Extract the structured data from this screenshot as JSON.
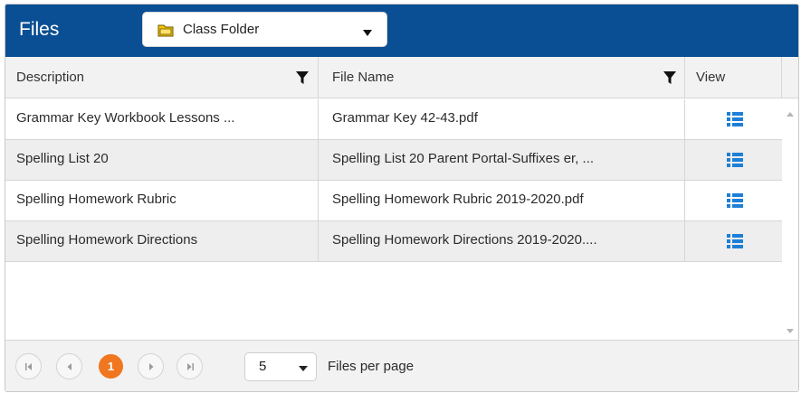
{
  "header": {
    "title": "Files",
    "folder_select": {
      "value": "Class Folder",
      "icon": "folder-icon"
    }
  },
  "grid": {
    "columns": {
      "description": "Description",
      "file_name": "File Name",
      "view": "View"
    },
    "rows": [
      {
        "description": "Grammar Key Workbook Lessons ...",
        "file_name": "Grammar Key 42-43.pdf",
        "view_icon": "list-view-icon"
      },
      {
        "description": "Spelling List 20",
        "file_name": "Spelling List 20 Parent Portal-Suffixes er, ...",
        "view_icon": "list-view-icon"
      },
      {
        "description": "Spelling Homework Rubric",
        "file_name": "Spelling Homework Rubric 2019-2020.pdf",
        "view_icon": "list-view-icon"
      },
      {
        "description": "Spelling Homework Directions",
        "file_name": "Spelling Homework Directions 2019-2020....",
        "view_icon": "list-view-icon"
      }
    ]
  },
  "pager": {
    "current_page": "1",
    "page_size": "5",
    "page_size_label": "Files per page"
  },
  "colors": {
    "header_bg": "#0a4f93",
    "current_page_bg": "#f0761f",
    "view_icon": "#1e7fd6",
    "alt_row_bg": "#eeeeee"
  }
}
